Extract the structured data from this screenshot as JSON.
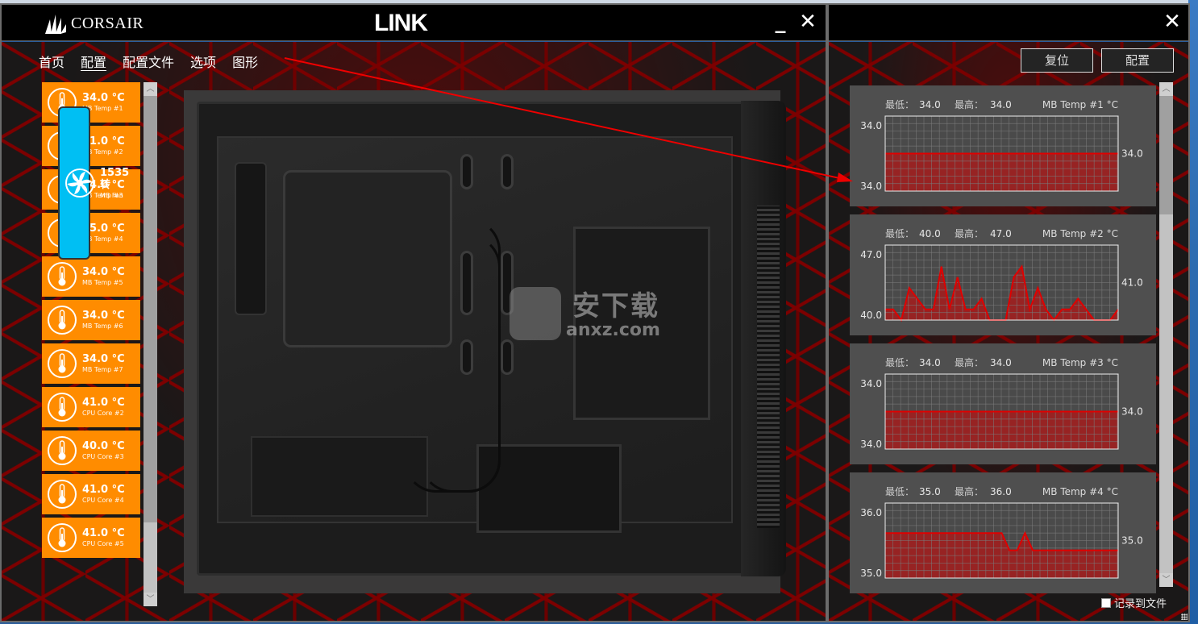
{
  "main_window": {
    "brand": "CORSAIR",
    "app_title": "LINK",
    "minimize_label": "_",
    "close_label": "✕",
    "nav": [
      {
        "label": "首页",
        "active": false
      },
      {
        "label": "配置",
        "active": true
      },
      {
        "label": "配置文件",
        "active": false
      },
      {
        "label": "选项",
        "active": false
      },
      {
        "label": "图形",
        "active": false
      }
    ],
    "sensors": [
      {
        "value": "34.0 °C",
        "label": "MB  Temp #1",
        "type": "temp",
        "color": "#ff8c00"
      },
      {
        "value": "41.0 °C",
        "label": "MB  Temp #2",
        "type": "temp",
        "color": "#ff8c00"
      },
      {
        "value": "34.0 °C",
        "label": "MB  Temp #3",
        "type": "temp",
        "color": "#ff8c00"
      },
      {
        "value": "35.0 °C",
        "label": "MB  Temp #4",
        "type": "temp",
        "color": "#ff8c00"
      },
      {
        "value": "34.0 °C",
        "label": "MB  Temp #5",
        "type": "temp",
        "color": "#ff8c00"
      },
      {
        "value": "34.0 °C",
        "label": "MB  Temp #6",
        "type": "temp",
        "color": "#ff8c00"
      },
      {
        "value": "34.0 °C",
        "label": "MB  Temp #7",
        "type": "temp",
        "color": "#ff8c00"
      },
      {
        "value": "1535 转",
        "label": "MB  Fan",
        "type": "fan",
        "color": "#00bff3"
      },
      {
        "value": "41.0 °C",
        "label": "CPU  Core #2",
        "type": "temp",
        "color": "#ff8c00"
      },
      {
        "value": "40.0 °C",
        "label": "CPU  Core #3",
        "type": "temp",
        "color": "#ff8c00"
      },
      {
        "value": "41.0 °C",
        "label": "CPU  Core #4",
        "type": "temp",
        "color": "#ff8c00"
      },
      {
        "value": "41.0 °C",
        "label": "CPU  Core #5",
        "type": "temp",
        "color": "#ff8c00"
      }
    ],
    "watermark": {
      "cn": "安下载",
      "en": "anxz.com"
    }
  },
  "graph_window": {
    "close_label": "✕",
    "reset_label": "复位",
    "config_label": "配置",
    "log_to_file_label": "记录到文件",
    "log_to_file_checked": false,
    "min_prefix": "最低：",
    "max_prefix": "最高：",
    "accent_color": "#e00000"
  },
  "chart_data": [
    {
      "type": "area",
      "title": "MB  Temp #1 °C",
      "min": "34.0",
      "max": "34.0",
      "current": "34.0",
      "ylim_labels": [
        "34.0",
        "34.0"
      ],
      "y_fraction": [
        0.5,
        0.5,
        0.5,
        0.5,
        0.5,
        0.5,
        0.5,
        0.5,
        0.5,
        0.5,
        0.5,
        0.5,
        0.5,
        0.5,
        0.5,
        0.5,
        0.5,
        0.5,
        0.5,
        0.5,
        0.5,
        0.5,
        0.5,
        0.5,
        0.5,
        0.5,
        0.5,
        0.5,
        0.5,
        0.5,
        0.5
      ]
    },
    {
      "type": "area",
      "title": "MB  Temp #2 °C",
      "min": "40.0",
      "max": "47.0",
      "current": "41.0",
      "ylim": [
        40,
        47
      ],
      "ylim_labels": [
        "47.0",
        "40.0"
      ],
      "values": [
        41,
        41,
        40,
        43,
        42,
        41,
        41,
        45,
        41,
        44,
        41,
        41,
        42,
        40,
        40,
        40,
        44,
        45,
        41,
        43,
        41,
        40,
        41,
        41,
        42,
        41,
        40,
        40,
        40,
        41
      ]
    },
    {
      "type": "area",
      "title": "MB  Temp #3 °C",
      "min": "34.0",
      "max": "34.0",
      "current": "34.0",
      "ylim_labels": [
        "34.0",
        "34.0"
      ],
      "y_fraction": [
        0.5,
        0.5,
        0.5,
        0.5,
        0.5,
        0.5,
        0.5,
        0.5,
        0.5,
        0.5,
        0.5,
        0.5,
        0.5,
        0.5,
        0.5,
        0.5,
        0.5,
        0.5,
        0.5,
        0.5,
        0.5,
        0.5,
        0.5,
        0.5,
        0.5,
        0.5,
        0.5,
        0.5,
        0.5,
        0.5,
        0.5
      ]
    },
    {
      "type": "area",
      "title": "MB  Temp #4 °C",
      "min": "35.0",
      "max": "36.0",
      "current": "35.0",
      "ylim_labels": [
        "36.0",
        "35.0"
      ],
      "y_fraction": [
        0.6,
        0.6,
        0.6,
        0.6,
        0.6,
        0.6,
        0.6,
        0.6,
        0.6,
        0.6,
        0.6,
        0.6,
        0.6,
        0.6,
        0.6,
        0.6,
        0.37,
        0.37,
        0.6,
        0.37,
        0.37,
        0.37,
        0.37,
        0.37,
        0.37,
        0.37,
        0.37,
        0.37,
        0.37,
        0.37,
        0.37
      ]
    }
  ]
}
